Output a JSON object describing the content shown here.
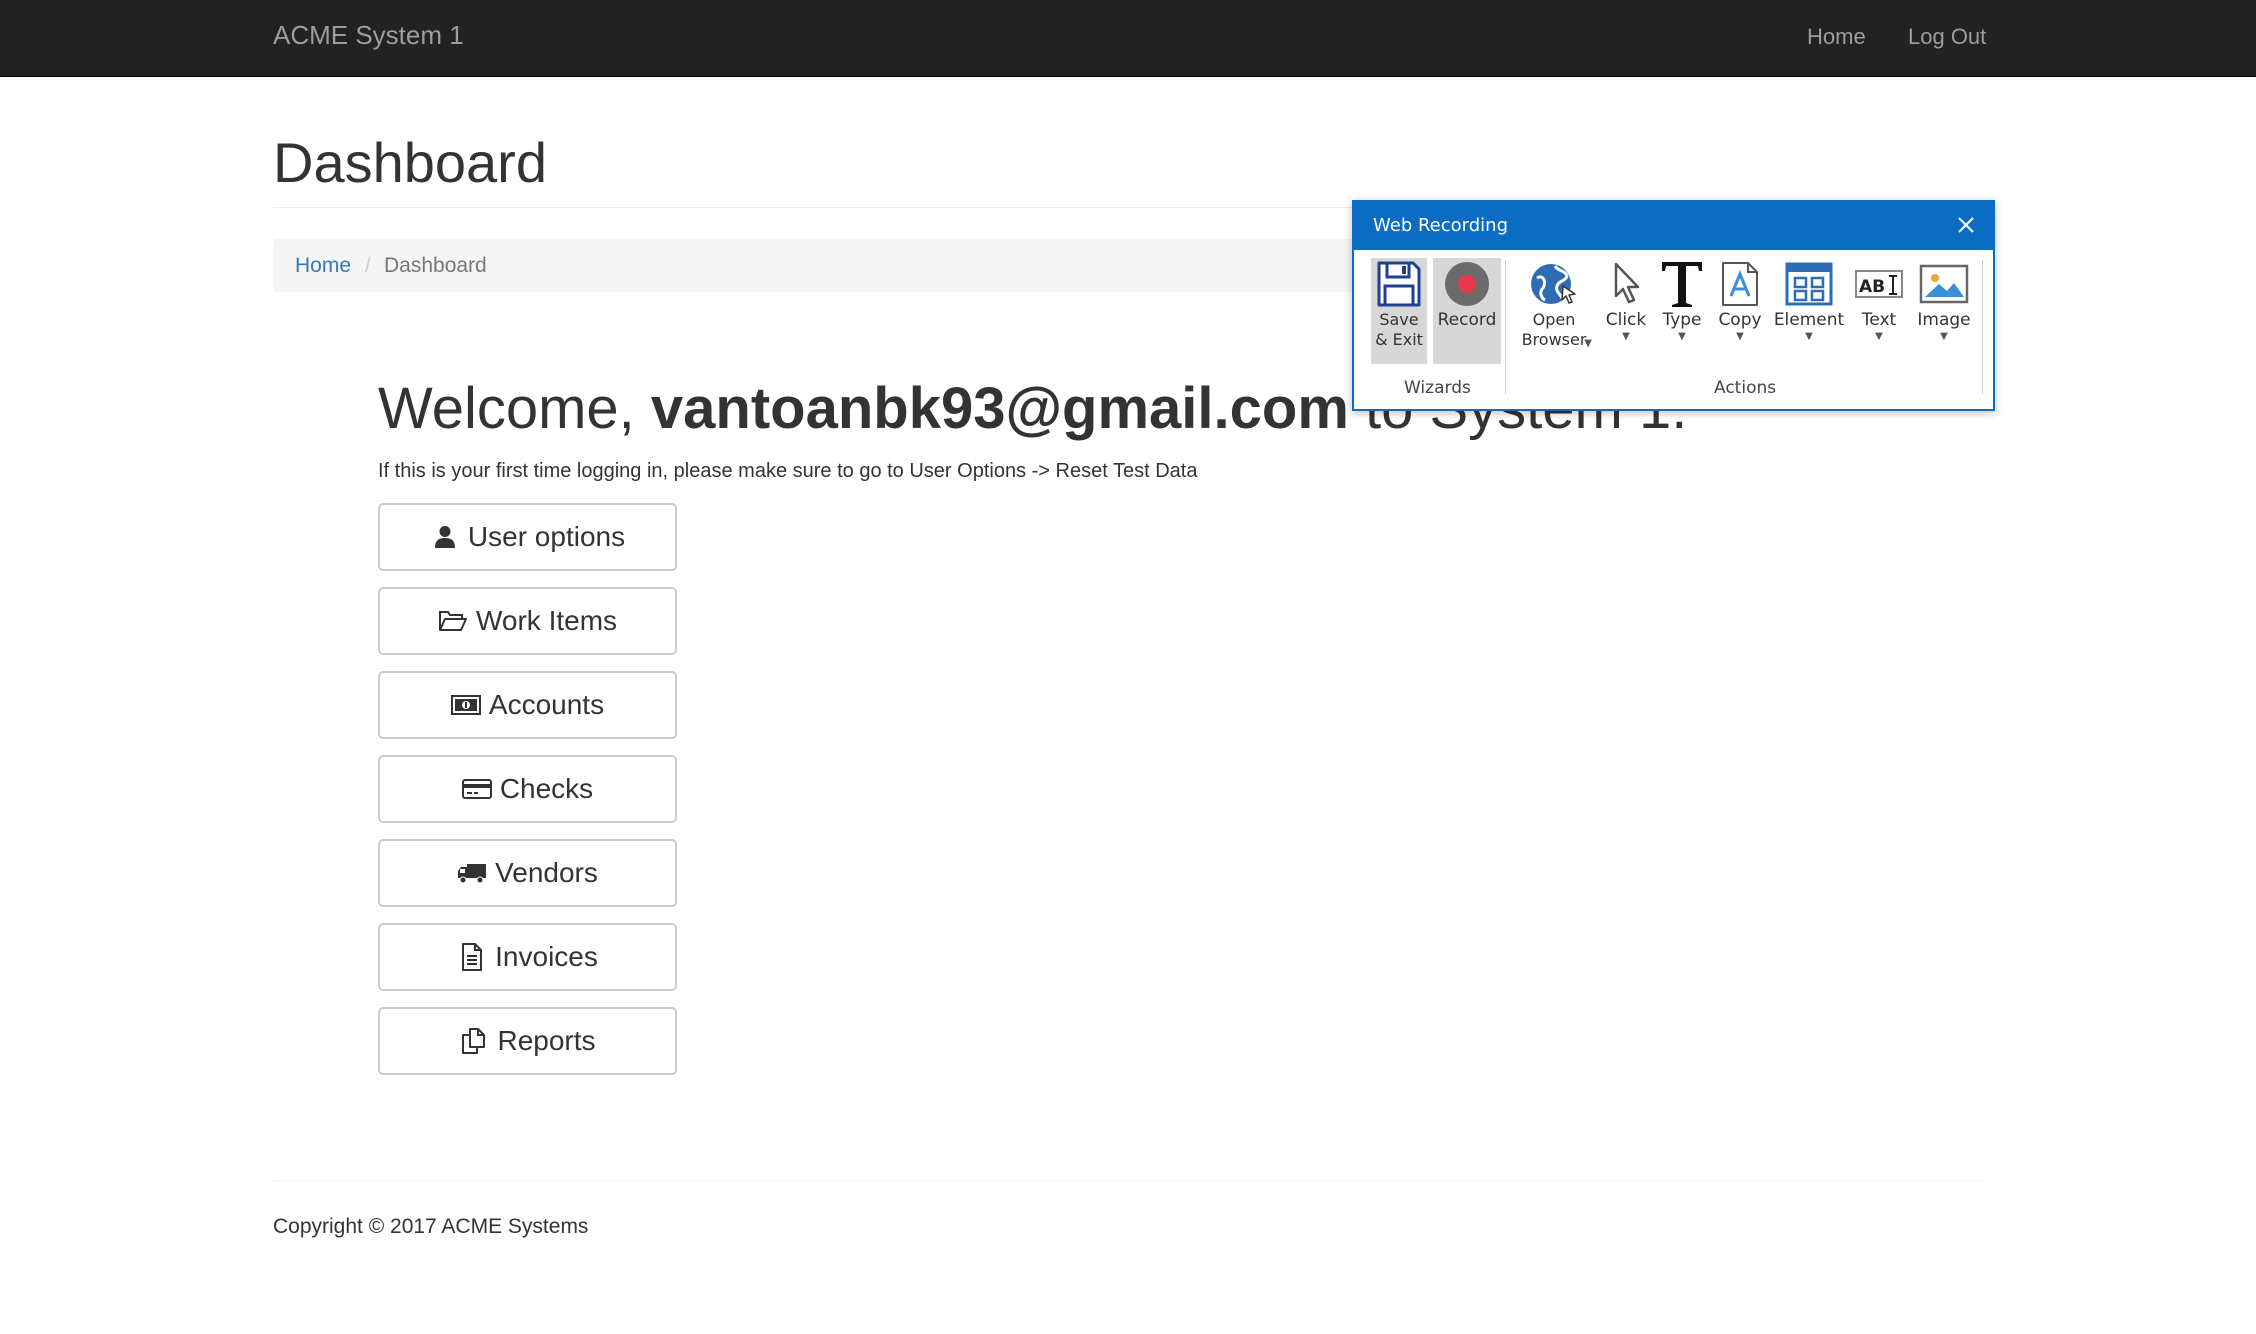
{
  "navbar": {
    "brand": "ACME System 1",
    "links": {
      "home": "Home",
      "logout": "Log Out"
    }
  },
  "page": {
    "title": "Dashboard",
    "breadcrumb": {
      "home": "Home",
      "separator": "/",
      "current": "Dashboard"
    },
    "welcome": {
      "prefix": "Welcome, ",
      "user": "vantoanbk93@gmail.com",
      "suffix": " to System 1."
    },
    "intro": "If this is your first time logging in, please make sure to go to User Options -> Reset Test Data"
  },
  "menu": [
    {
      "label": "User options",
      "icon": "user-icon"
    },
    {
      "label": "Work Items",
      "icon": "folder-open-icon"
    },
    {
      "label": "Accounts",
      "icon": "money-icon"
    },
    {
      "label": "Checks",
      "icon": "credit-card-icon"
    },
    {
      "label": "Vendors",
      "icon": "truck-icon"
    },
    {
      "label": "Invoices",
      "icon": "file-text-icon"
    },
    {
      "label": "Reports",
      "icon": "copy-icon"
    }
  ],
  "footer": {
    "copyright": "Copyright © 2017 ACME Systems"
  },
  "recorder": {
    "title": "Web Recording",
    "groups": {
      "wizards": "Wizards",
      "actions": "Actions"
    },
    "tools": {
      "save": "Save\n& Exit",
      "record": "Record",
      "open_browser": "Open\nBrowser",
      "click": "Click",
      "type": "Type",
      "copy": "Copy",
      "element": "Element",
      "text": "Text",
      "image": "Image"
    },
    "colors": {
      "titlebar": "#0a6cc2",
      "record_dot": "#e8384f"
    }
  }
}
